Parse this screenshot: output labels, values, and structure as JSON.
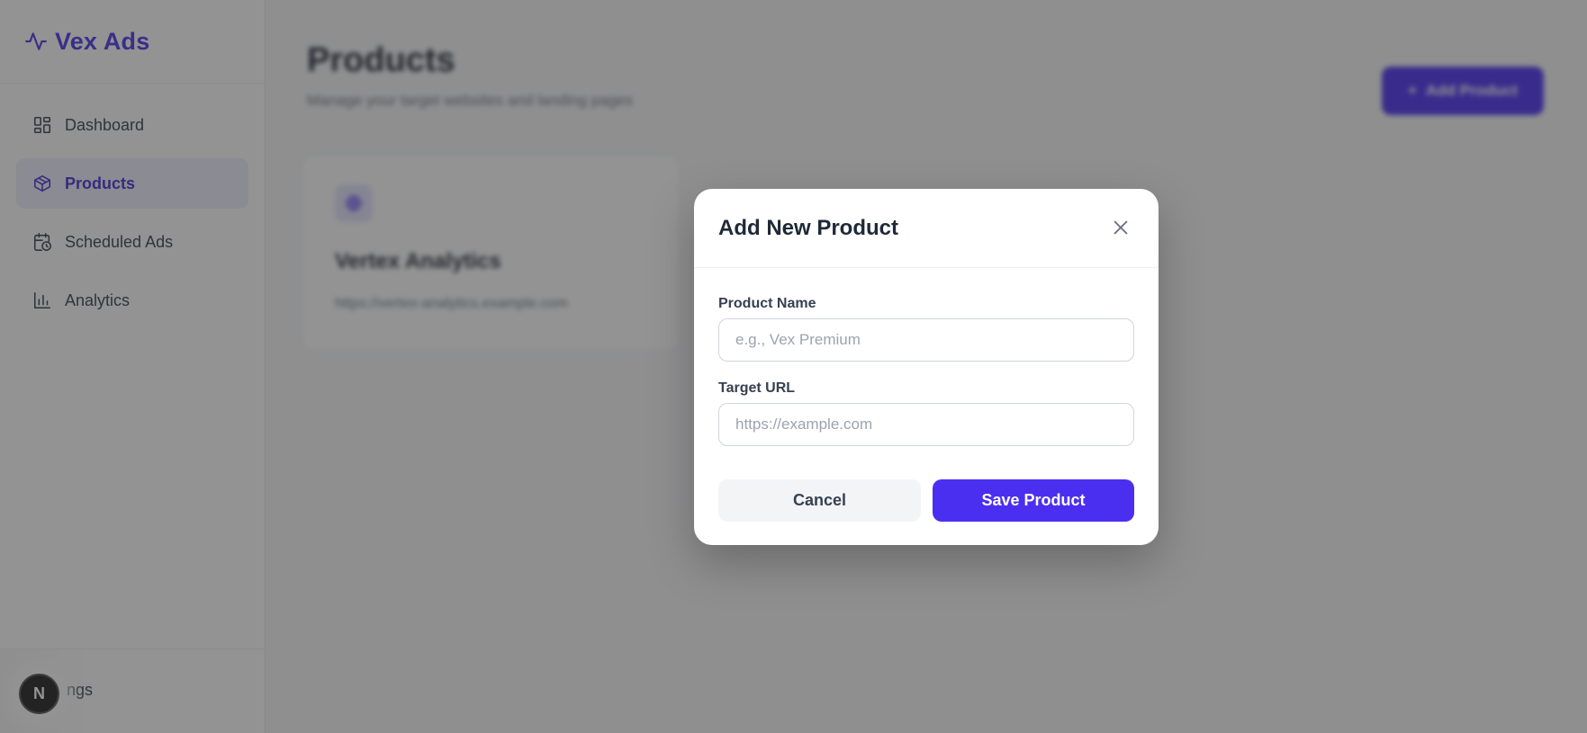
{
  "brand": {
    "name": "Vex Ads",
    "icon": "activity-icon",
    "color": "#4f35e8"
  },
  "sidebar": {
    "items": [
      {
        "label": "Dashboard",
        "icon": "dashboard-icon",
        "active": false
      },
      {
        "label": "Products",
        "icon": "box-icon",
        "active": true
      },
      {
        "label": "Scheduled Ads",
        "icon": "calendar-clock-icon",
        "active": false
      },
      {
        "label": "Analytics",
        "icon": "bar-chart-icon",
        "active": false
      }
    ],
    "footer": {
      "settings_label": "ngs",
      "user_initial": "N"
    }
  },
  "main": {
    "title": "Products",
    "subtitle": "Manage your target websites and landing pages",
    "add_button_label": "Add Product",
    "card": {
      "title": "Vertex Analytics",
      "url": "https://vertex-analytics.example.com"
    }
  },
  "modal": {
    "title": "Add New Product",
    "product_name_label": "Product Name",
    "product_name_placeholder": "e.g., Vex Premium",
    "product_name_value": "",
    "target_url_label": "Target URL",
    "target_url_placeholder": "https://example.com",
    "target_url_value": "",
    "cancel_label": "Cancel",
    "save_label": "Save Product"
  },
  "colors": {
    "accent": "#4b2ff0",
    "active_bg": "#eceefe",
    "overlay": "rgba(40,40,40,0.5)"
  }
}
